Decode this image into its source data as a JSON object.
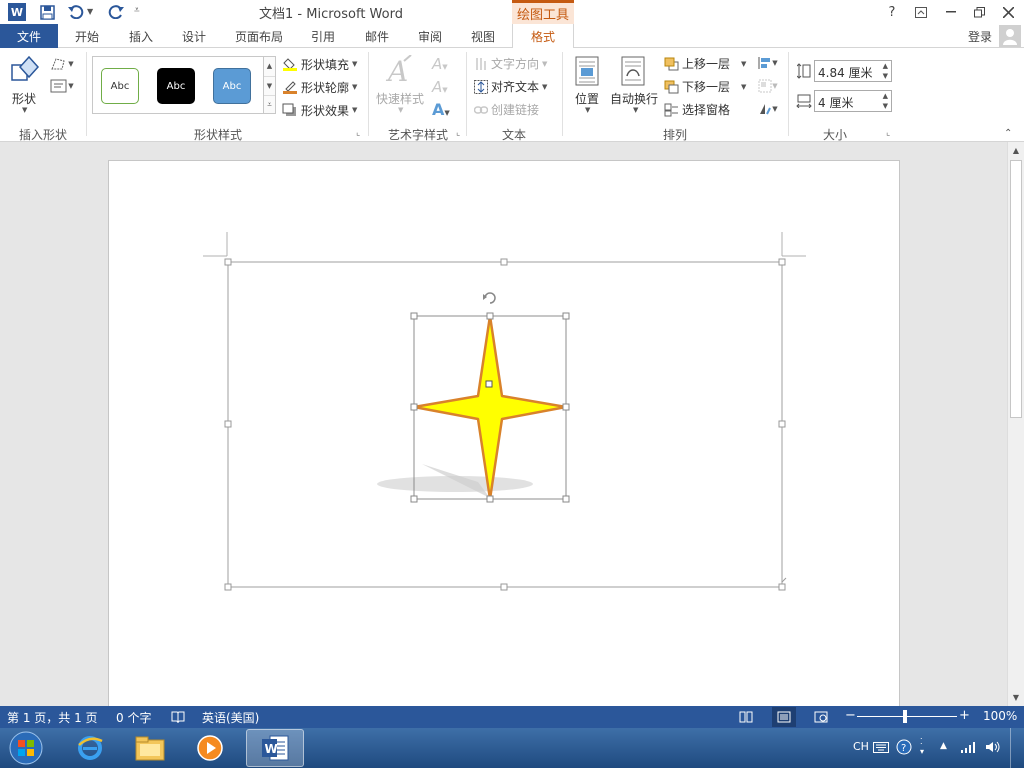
{
  "window": {
    "title": "文档1 - Microsoft Word",
    "contextual_tab": "绘图工具",
    "help": "?",
    "signin": "登录"
  },
  "tabs": [
    {
      "label": "文件"
    },
    {
      "label": "开始"
    },
    {
      "label": "插入"
    },
    {
      "label": "设计"
    },
    {
      "label": "页面布局"
    },
    {
      "label": "引用"
    },
    {
      "label": "邮件"
    },
    {
      "label": "审阅"
    },
    {
      "label": "视图"
    },
    {
      "label": "格式"
    }
  ],
  "ribbon": {
    "insert_shapes": {
      "shapes_label": "形状",
      "group": "插入形状"
    },
    "shape_styles": {
      "swatches": [
        "Abc",
        "Abc",
        "Abc"
      ],
      "fill": "形状填充",
      "outline": "形状轮廓",
      "effects": "形状效果",
      "group": "形状样式"
    },
    "wordart": {
      "quick_styles": "快速样式",
      "group": "艺术字样式"
    },
    "text": {
      "direction": "文字方向",
      "align": "对齐文本",
      "link": "创建链接",
      "group": "文本"
    },
    "arrange": {
      "position": "位置",
      "wrap": "自动换行",
      "forward": "上移一层",
      "backward": "下移一层",
      "pane": "选择窗格",
      "group": "排列"
    },
    "size": {
      "height": "4.84 厘米",
      "width": "4 厘米",
      "group": "大小"
    }
  },
  "status": {
    "page": "第 1 页，共 1 页",
    "words": "0 个字",
    "language": "英语(美国)",
    "zoom": "100%",
    "zoom_minus": "−",
    "zoom_plus": "+"
  },
  "tray": {
    "lang": "CH"
  },
  "colors": {
    "word_blue": "#2b579a",
    "contextual": "#c55a11",
    "star_fill": "#ffff00",
    "star_outline": "#d9822b"
  }
}
